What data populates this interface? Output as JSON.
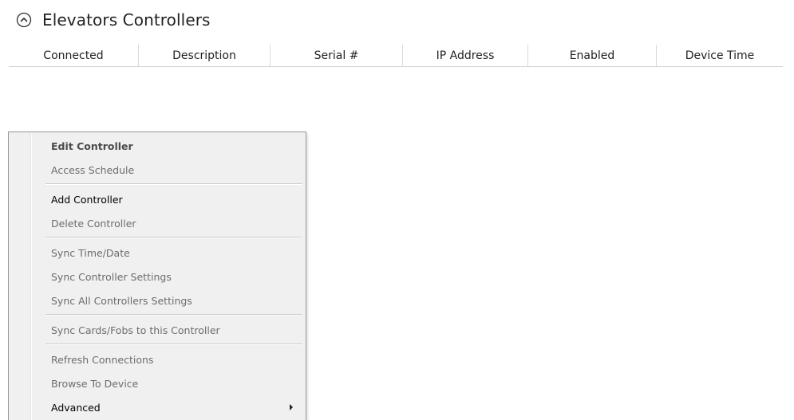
{
  "section": {
    "title": "Elevators Controllers",
    "collapse_icon": "chevron-up-circle-icon"
  },
  "grid": {
    "columns": [
      {
        "label": "Connected"
      },
      {
        "label": "Description"
      },
      {
        "label": "Serial #"
      },
      {
        "label": "IP Address"
      },
      {
        "label": "Enabled"
      },
      {
        "label": "Device Time"
      }
    ]
  },
  "context_menu": {
    "items": [
      {
        "label": "Edit Controller",
        "state": "default-bold"
      },
      {
        "label": "Access Schedule",
        "state": "disabled"
      },
      {
        "label": "Add Controller",
        "state": "enabled"
      },
      {
        "label": "Delete Controller",
        "state": "disabled"
      },
      {
        "label": "Sync Time/Date",
        "state": "disabled"
      },
      {
        "label": "Sync Controller Settings",
        "state": "disabled"
      },
      {
        "label": "Sync All Controllers Settings",
        "state": "disabled"
      },
      {
        "label": "Sync Cards/Fobs to this Controller",
        "state": "disabled"
      },
      {
        "label": "Refresh Connections",
        "state": "disabled"
      },
      {
        "label": "Browse To Device",
        "state": "disabled"
      },
      {
        "label": "Advanced",
        "state": "enabled",
        "submenu_icon": "submenu-arrow-icon"
      }
    ]
  }
}
